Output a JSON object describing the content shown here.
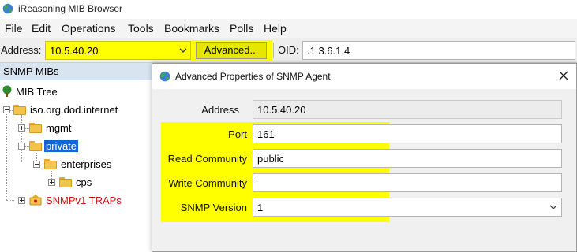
{
  "window": {
    "title": "iReasoning MIB Browser"
  },
  "menu": [
    "File",
    "Edit",
    "Operations",
    "Tools",
    "Bookmarks",
    "Polls",
    "Help"
  ],
  "toolbar": {
    "address_label": "Address:",
    "address_value": "10.5.40.20",
    "advanced_label": "Advanced...",
    "oid_label": "OID:",
    "oid_value": ".1.3.6.1.4"
  },
  "mib_panel": {
    "header": "SNMP MIBs",
    "tree": {
      "root": "MIB Tree",
      "node_internet": "iso.org.dod.internet",
      "node_mgmt": "mgmt",
      "node_private": "private",
      "node_enterprises": "enterprises",
      "node_cps": "cps",
      "node_traps": "SNMPv1 TRAPs"
    }
  },
  "dialog": {
    "title": "Advanced Properties of SNMP Agent",
    "fields": {
      "address_label": "Address",
      "address_value": "10.5.40.20",
      "port_label": "Port",
      "port_value": "161",
      "read_label": "Read Community",
      "read_value": "public",
      "write_label": "Write Community",
      "write_value": "",
      "version_label": "SNMP Version",
      "version_value": "1"
    }
  },
  "colors": {
    "highlight": "#ffff00",
    "selection": "#1565d8",
    "trap_text": "#d01010"
  },
  "icons": {
    "app": "globe-icon",
    "tree_root": "tree-icon",
    "folder": "folder-icon",
    "trap": "trap-icon",
    "close": "close-icon",
    "dropdown": "chevron-down-icon"
  }
}
